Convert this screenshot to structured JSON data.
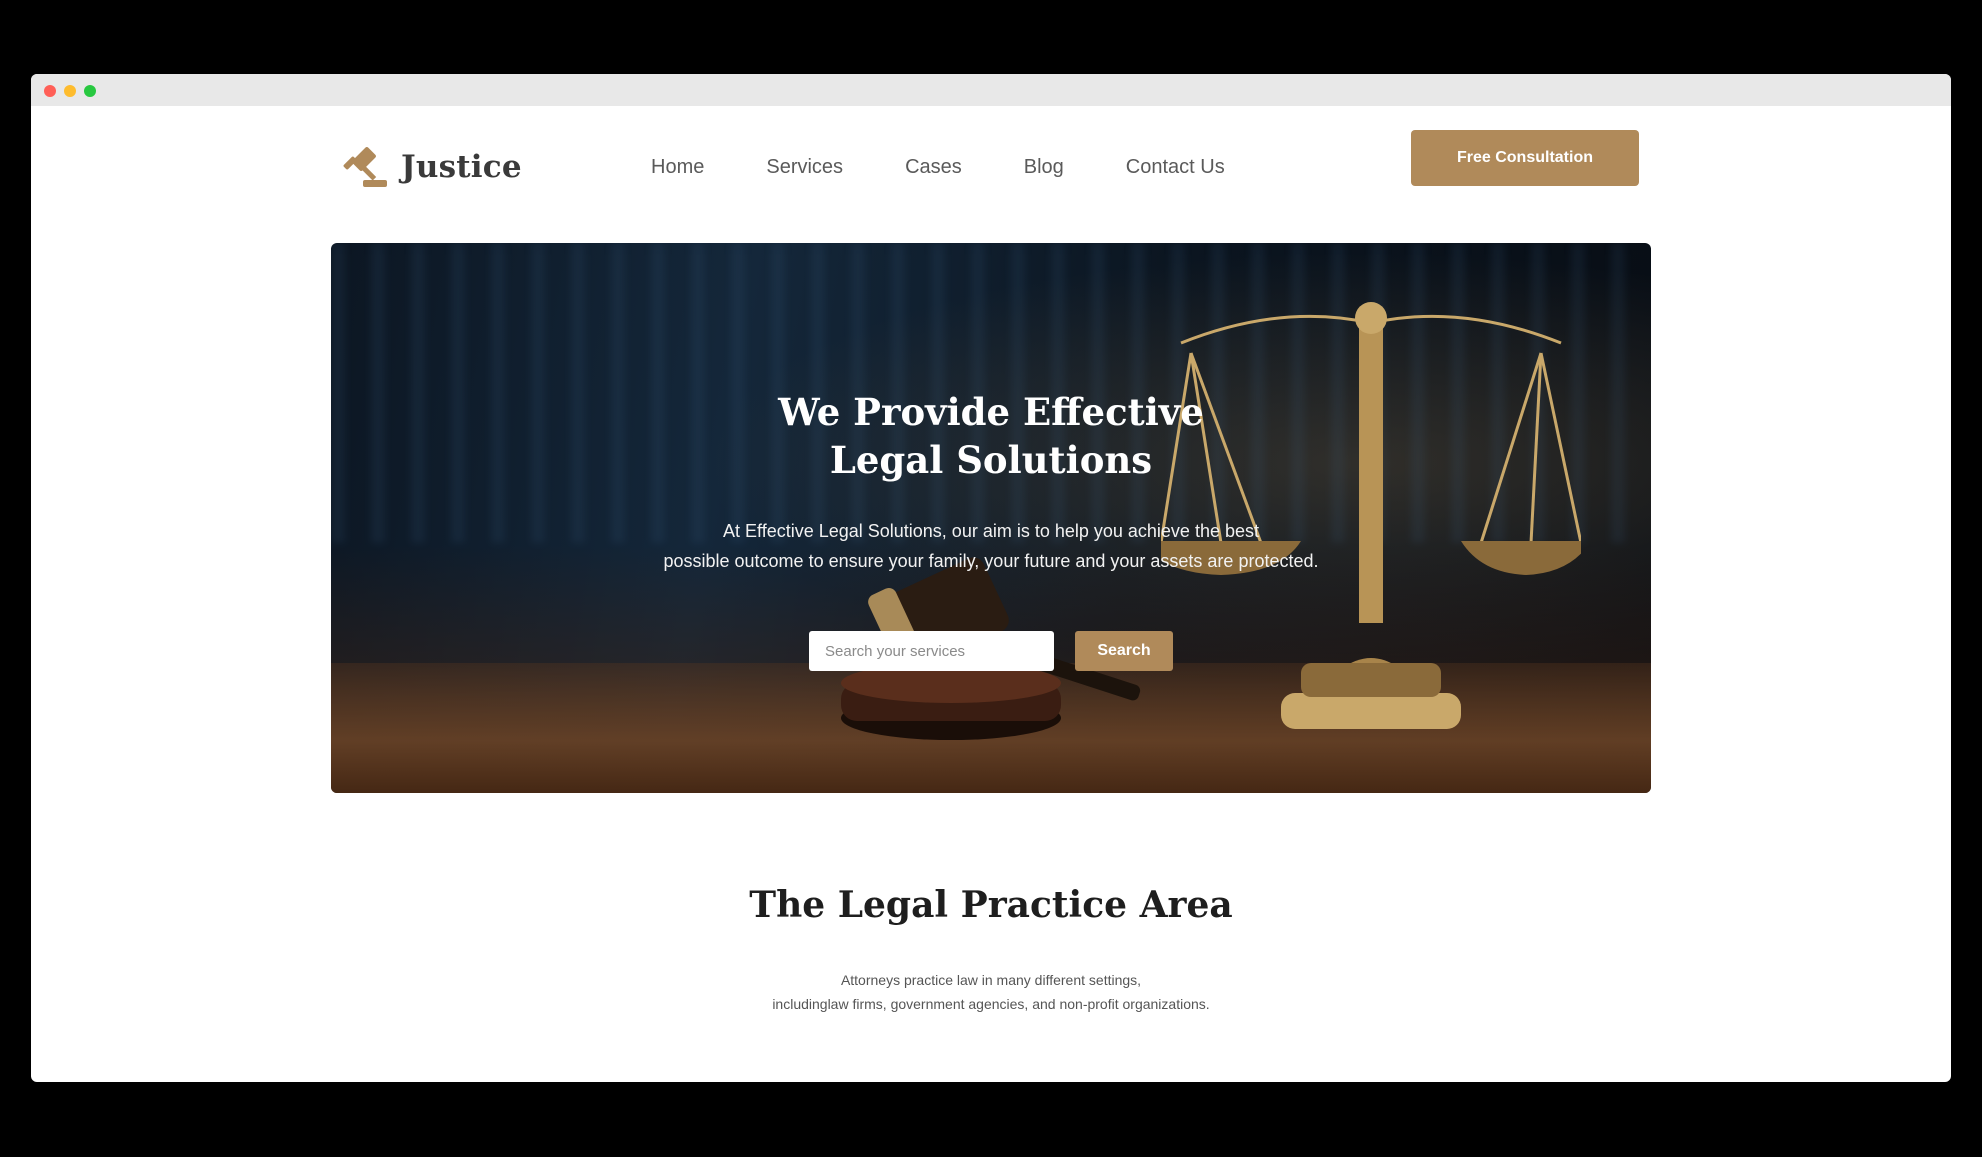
{
  "brand": {
    "name": "Justice",
    "logo_icon": "gavel-icon",
    "accent_color": "#b08a5a"
  },
  "nav": {
    "items": [
      {
        "label": "Home"
      },
      {
        "label": "Services"
      },
      {
        "label": "Cases"
      },
      {
        "label": "Blog"
      },
      {
        "label": "Contact Us"
      }
    ]
  },
  "header": {
    "cta_label": "Free Consultation"
  },
  "hero": {
    "title_line1": "We Provide Effective",
    "title_line2": "Legal Solutions",
    "desc_line1": "At Effective Legal Solutions, our aim is to help you achieve the best",
    "desc_line2": "possible outcome to ensure your family, your future and your assets are protected.",
    "search": {
      "placeholder": "Search your services",
      "value": "",
      "button_label": "Search"
    }
  },
  "practice": {
    "title": "The Legal Practice Area",
    "desc_line1": "Attorneys practice law in many different settings,",
    "desc_line2": "includinglaw firms, government agencies, and non-profit organizations."
  }
}
